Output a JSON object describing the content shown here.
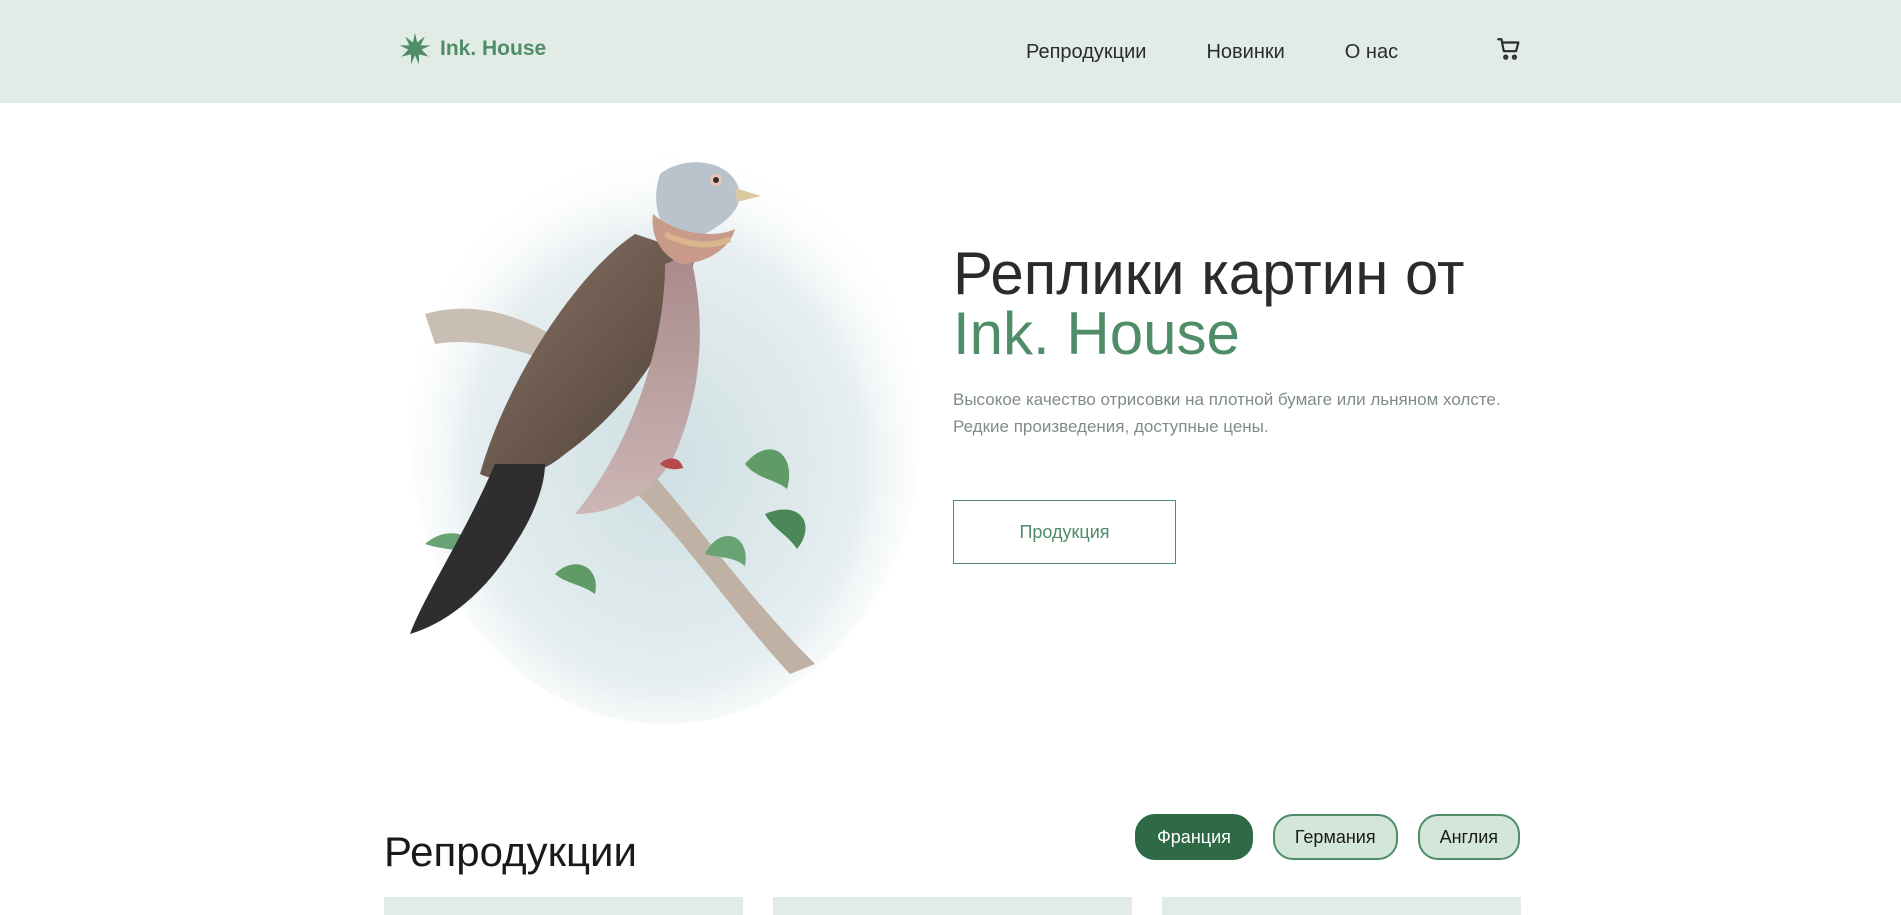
{
  "header": {
    "logo_text": "Ink. House",
    "nav": [
      {
        "label": "Репродукции"
      },
      {
        "label": "Новинки"
      },
      {
        "label": "О нас"
      }
    ]
  },
  "hero": {
    "title_line1": "Реплики картин от",
    "title_line2": "Ink. House",
    "description": "Высокое качество отрисовки на плотной бумаге или льняном холсте. Редкие произведения, доступные цены.",
    "cta_label": "Продукция"
  },
  "reproductions": {
    "title": "Репродукции",
    "filters": [
      {
        "label": "Франция",
        "active": true
      },
      {
        "label": "Германия",
        "active": false
      },
      {
        "label": "Англия",
        "active": false
      }
    ]
  },
  "colors": {
    "header_bg": "#e1ece6",
    "accent": "#4e8d68",
    "filter_active": "#2e6a45",
    "filter_bg": "#d3e6da"
  },
  "icons": [
    "starburst-logo-icon",
    "cart-icon"
  ]
}
